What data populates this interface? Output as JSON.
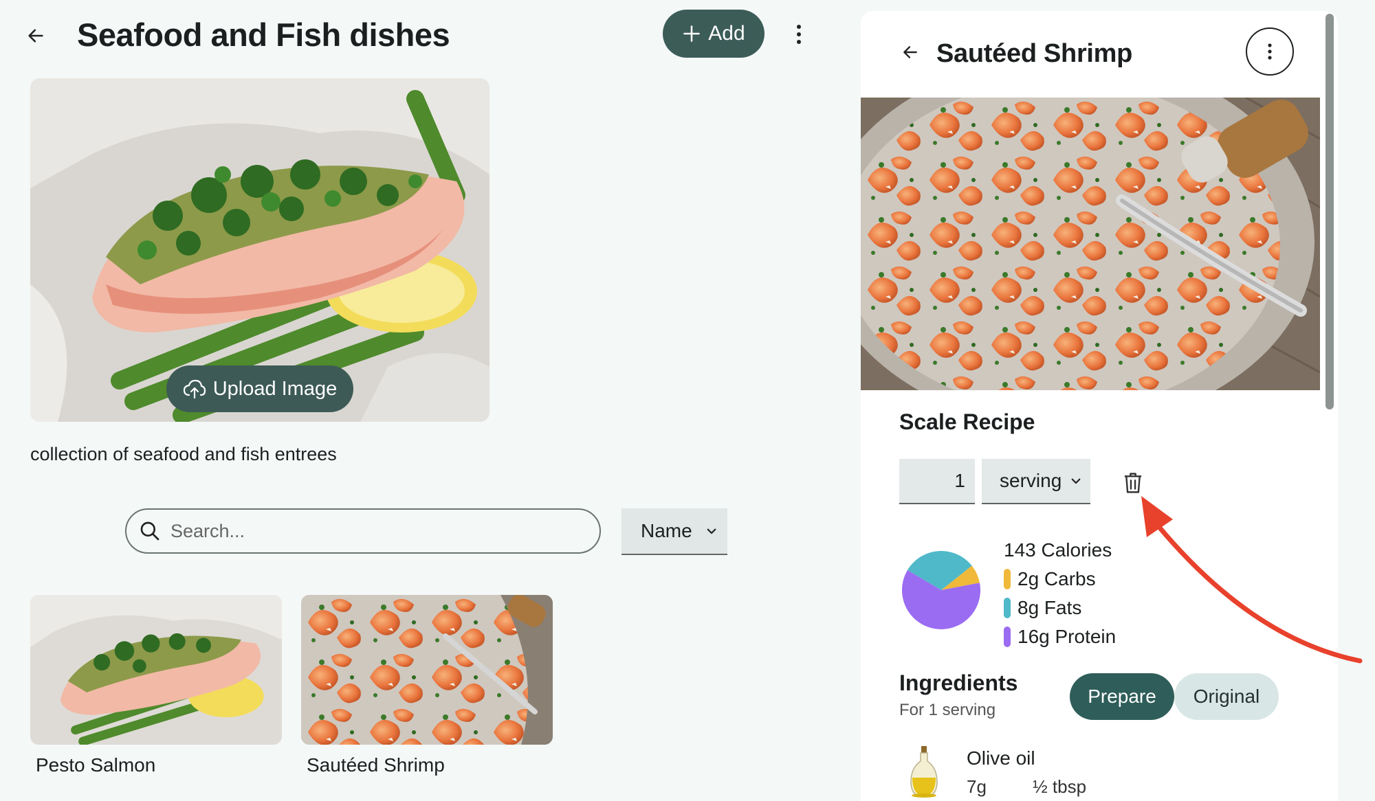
{
  "header": {
    "title": "Seafood and Fish dishes",
    "add_label": "Add"
  },
  "collection": {
    "upload_label": "Upload Image",
    "description": "collection of seafood and fish entrees"
  },
  "search": {
    "placeholder": "Search...",
    "sort_value": "Name"
  },
  "recipes": [
    {
      "name": "Pesto Salmon"
    },
    {
      "name": "Sautéed Shrimp"
    }
  ],
  "detail": {
    "title": "Sautéed Shrimp",
    "scale_heading": "Scale Recipe",
    "quantity": "1",
    "unit": "serving",
    "calories": "143 Calories",
    "macros": [
      {
        "label": "2g Carbs",
        "color": "#f0b93a",
        "grams": 2
      },
      {
        "label": "8g Fats",
        "color": "#4fb9c9",
        "grams": 8
      },
      {
        "label": "16g Protein",
        "color": "#9a6cf2",
        "grams": 16
      }
    ],
    "ingredients_heading": "Ingredients",
    "ingredients_sub": "For 1 serving",
    "toggle_on": "Prepare",
    "toggle_off": "Original",
    "ingredients": [
      {
        "name": "Olive oil",
        "weight": "7g",
        "amount": "½ tbsp"
      }
    ]
  },
  "colors": {
    "accent": "#3c5c58",
    "annotation_arrow": "#e8412c"
  }
}
